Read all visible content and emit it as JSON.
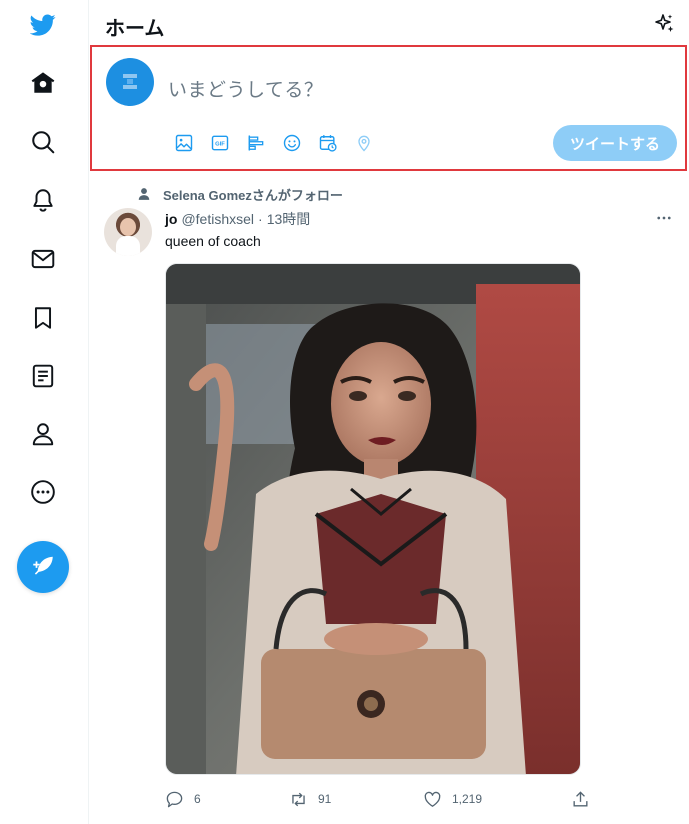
{
  "nav": {
    "items": [
      {
        "name": "twitter-logo-icon"
      },
      {
        "name": "home-icon"
      },
      {
        "name": "explore-search-icon"
      },
      {
        "name": "notifications-bell-icon"
      },
      {
        "name": "messages-mail-icon"
      },
      {
        "name": "bookmarks-icon"
      },
      {
        "name": "lists-icon"
      },
      {
        "name": "profile-icon"
      },
      {
        "name": "more-options-icon"
      }
    ],
    "compose_icon": "compose-feather-icon"
  },
  "header": {
    "title": "ホーム",
    "top_tweets_icon": "sparkle-icon"
  },
  "composer": {
    "placeholder": "いまどうしてる？",
    "tools": [
      "image-icon",
      "gif-icon",
      "poll-icon",
      "emoji-icon",
      "schedule-icon",
      "location-icon"
    ],
    "gif_label": "GIF",
    "tweet_button": "ツイートする",
    "highlight_color": "#e0393e"
  },
  "tweet": {
    "context": "Selena Gomezさんがフォロー",
    "author_name": "jo",
    "author_handle": "@fetishxsel",
    "separator": "·",
    "time": "13時間",
    "text": "queen of coach",
    "actions": {
      "replies": "6",
      "retweets": "91",
      "likes": "1,219"
    }
  },
  "colors": {
    "accent": "#1d9bf0",
    "tweet_button_disabled": "#8ecdf7",
    "secondary_text": "#536471"
  }
}
